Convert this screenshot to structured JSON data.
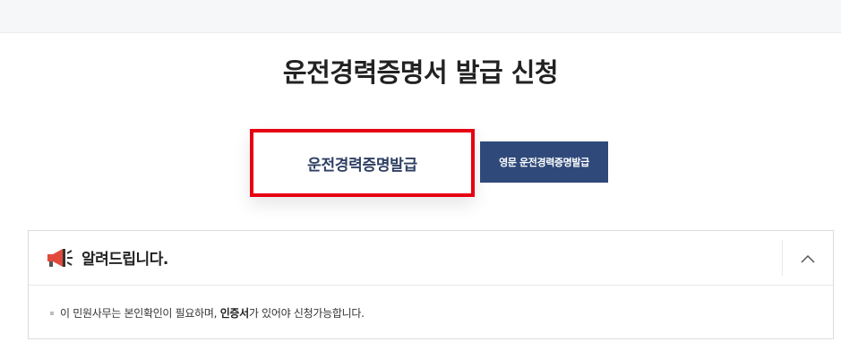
{
  "page": {
    "title": "운전경력증명서 발급 신청"
  },
  "tabs": {
    "primary_label": "운전경력증명발급",
    "secondary_label": "영문 운전경력증명발급"
  },
  "notice": {
    "title": "알려드립니다.",
    "text_before": "이 민원사무는 본인확인이 필요하며, ",
    "text_emphasis": "인증서",
    "text_after": "가 있어야 신청가능합니다."
  },
  "icons": {
    "notice_icon": "megaphone-icon",
    "toggle_icon": "chevron-up-icon"
  },
  "colors": {
    "selection_border": "#e60012",
    "primary_tab_text": "#2f3f63",
    "secondary_tab_bg": "#2f4a7a",
    "megaphone_red": "#e14a3b"
  }
}
